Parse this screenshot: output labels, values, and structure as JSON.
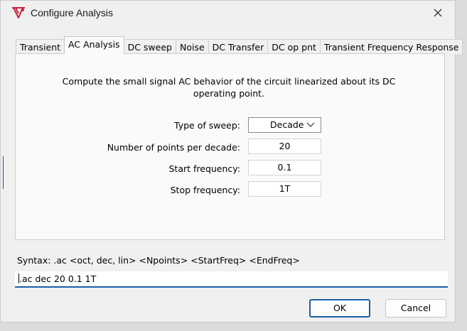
{
  "window": {
    "title": "Configure Analysis",
    "icons": {
      "app": "ltspice-probe-icon",
      "close": "close-icon"
    }
  },
  "tabs": [
    {
      "label": "Transient",
      "active": false
    },
    {
      "label": "AC Analysis",
      "active": true
    },
    {
      "label": "DC sweep",
      "active": false
    },
    {
      "label": "Noise",
      "active": false
    },
    {
      "label": "DC Transfer",
      "active": false
    },
    {
      "label": "DC op pnt",
      "active": false
    },
    {
      "label": "Transient Frequency Response",
      "active": false
    }
  ],
  "panel": {
    "description_line1": "Compute the small signal AC behavior of the circuit linearized about its DC",
    "description_line2": "operating point.",
    "fields": {
      "sweep_type": {
        "label": "Type of sweep:",
        "value": "Decade",
        "options": [
          "Decade"
        ]
      },
      "points": {
        "label": "Number of points per decade:",
        "value": "20"
      },
      "start_freq": {
        "label": "Start frequency:",
        "value": "0.1"
      },
      "stop_freq": {
        "label": "Stop frequency:",
        "value": "1T"
      }
    }
  },
  "syntax": {
    "text": "Syntax:  .ac <oct, dec, lin> <Npoints> <StartFreq> <EndFreq>",
    "command": ".ac dec 20 0.1 1T"
  },
  "buttons": {
    "ok": "OK",
    "cancel": "Cancel"
  },
  "colors": {
    "accent": "#1a5fa8",
    "icon_red": "#c8203a"
  }
}
